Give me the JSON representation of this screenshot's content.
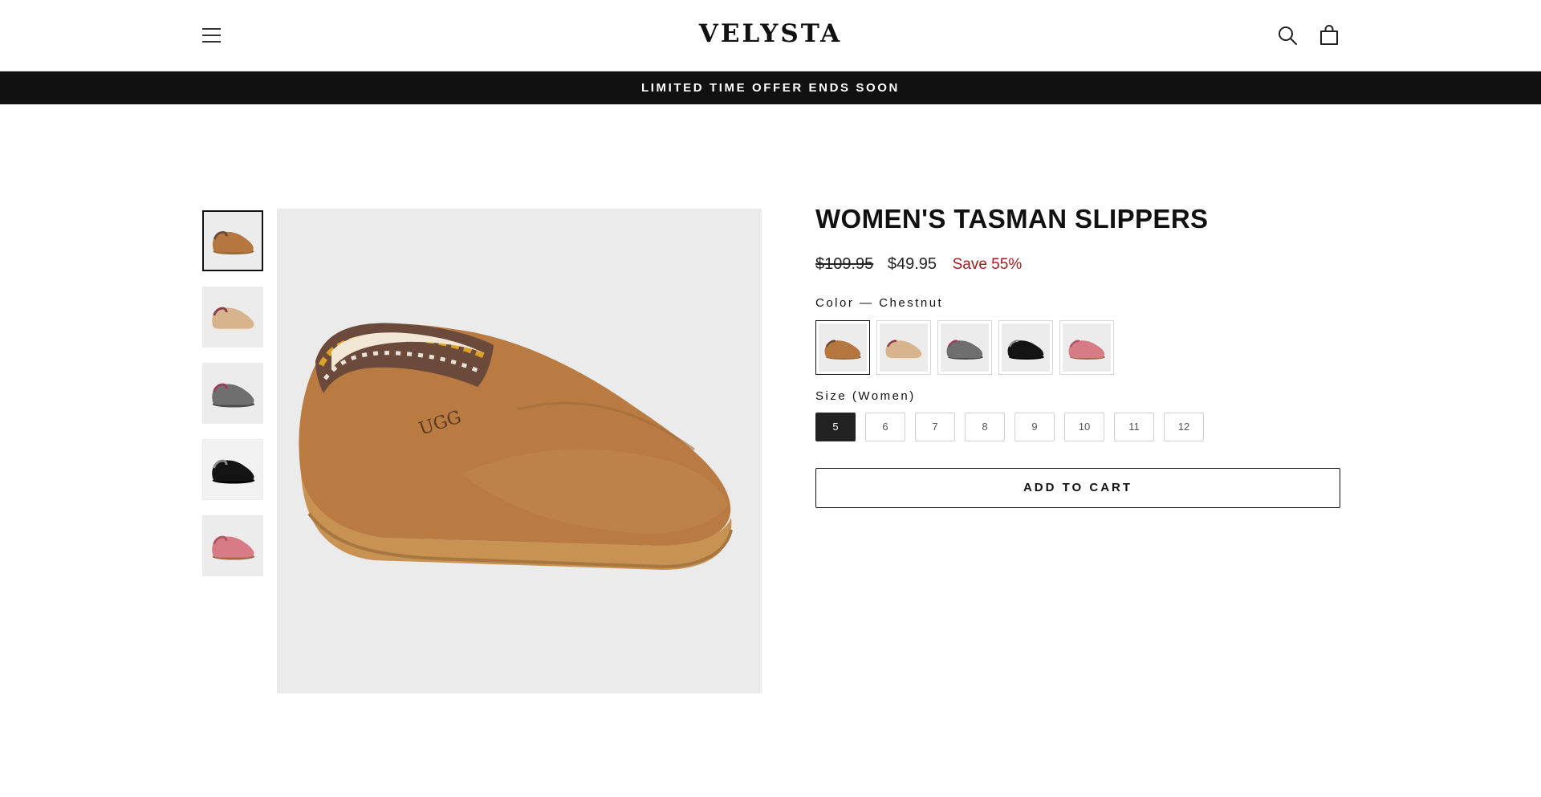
{
  "header": {
    "logo": "VELYSTA",
    "menu_icon": "hamburger-menu-icon",
    "search_icon": "search-icon",
    "cart_icon": "shopping-bag-icon"
  },
  "banner": {
    "text": "LIMITED TIME OFFER ENDS SOON"
  },
  "gallery": {
    "thumbnails": [
      {
        "color": "Chestnut",
        "hex": "#b5773f"
      },
      {
        "color": "Sand",
        "hex": "#d7b48e"
      },
      {
        "color": "Grey",
        "hex": "#6f6f6f"
      },
      {
        "color": "Black",
        "hex": "#141414"
      },
      {
        "color": "Pink",
        "hex": "#d77c86"
      }
    ],
    "active_index": 0,
    "main_image_brand_mark": "UGG"
  },
  "product": {
    "title": "WOMEN'S TASMAN SLIPPERS",
    "price_original": "$109.95",
    "price_sale": "$49.95",
    "save_text": "Save 55%",
    "color_label": "Color — Chestnut",
    "size_label": "Size (Women)",
    "colors": [
      {
        "name": "Chestnut",
        "hex": "#b5773f"
      },
      {
        "name": "Sand",
        "hex": "#d7b48e"
      },
      {
        "name": "Grey",
        "hex": "#6f6f6f"
      },
      {
        "name": "Black",
        "hex": "#141414"
      },
      {
        "name": "Pink",
        "hex": "#d77c86"
      }
    ],
    "selected_color_index": 0,
    "sizes": [
      "5",
      "6",
      "7",
      "8",
      "9",
      "10",
      "11",
      "12"
    ],
    "selected_size": "5",
    "add_to_cart_label": "ADD TO CART"
  },
  "colors": {
    "banner_bg": "#111111",
    "save_red": "#a31c1c",
    "image_bg": "#ebebeb"
  }
}
